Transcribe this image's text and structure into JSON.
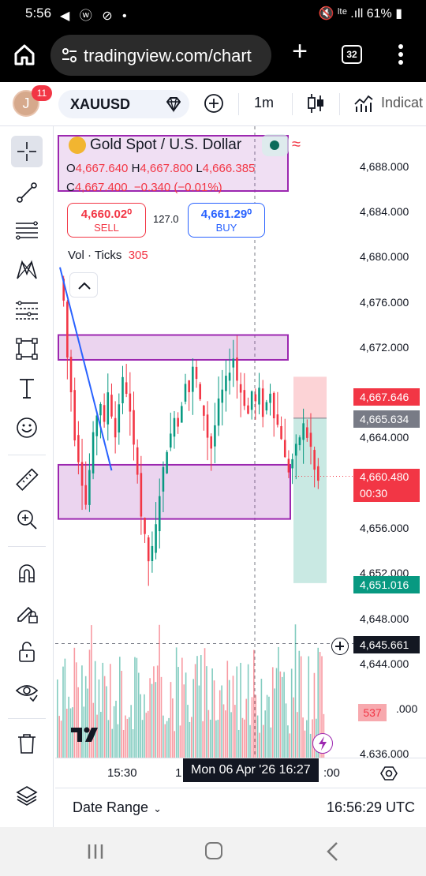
{
  "status_bar": {
    "time": "5:56",
    "icons": "◀ ⓦ ⊘ •",
    "right": "🔇 ˡᵗᵉ .ıll 61% ▮",
    "battery": "61%"
  },
  "browser": {
    "url": "tradingview.com/chart",
    "tab_count": "32"
  },
  "toolbar": {
    "avatar_letter": "J",
    "notification_count": "11",
    "symbol": "XAUUSD",
    "interval": "1m",
    "indicators_label": "Indicat"
  },
  "legend": {
    "title": "Gold Spot / U.S. Dollar",
    "wave_symbol": "≈",
    "open_key": "O",
    "open": "4,667.640",
    "high_key": "H",
    "high": "4,667.800",
    "low_key": "L",
    "low": "4,666.385",
    "close_key": "C",
    "close": "4,667.400",
    "change": "−0.340 (−0.01%)"
  },
  "trade": {
    "sell_price": "4,660.02⁰",
    "sell_label": "SELL",
    "spread": "127.0",
    "buy_price": "4,661.29⁰",
    "buy_label": "BUY"
  },
  "volume_indicator": {
    "label": "Vol · Ticks",
    "value": "305",
    "badge": "537"
  },
  "price_axis": {
    "ticks": [
      "4,688.000",
      "4,684.000",
      "4,680.000",
      "4,676.000",
      "4,672.000",
      "4,664.000",
      "4,656.000",
      "4,652.000",
      "4,648.000",
      "4,644.000",
      ".000",
      "4.636.000"
    ],
    "tick_values": [
      4688,
      4684,
      4680,
      4676,
      4672,
      4664,
      4656,
      4652,
      4648,
      4644,
      4640,
      4636
    ],
    "labels": {
      "take_profit": "4,667.646",
      "entry": "4,665.634",
      "last_price": "4,660.480",
      "countdown": "00:30",
      "stop": "4,651.016",
      "crosshair": "4,645.661"
    }
  },
  "time_axis": {
    "left_label": "15:30",
    "partial_label": "1",
    "right_partial": ":00",
    "crosshair_label": "Mon 06 Apr '26   16:27"
  },
  "bottom_bar": {
    "date_range": "Date Range",
    "clock": "16:56:29 UTC"
  },
  "colors": {
    "up": "#089981",
    "down": "#f23645",
    "zone": "#9c27b0",
    "zone_fill": "rgba(156,39,176,0.2)",
    "trend": "#2962ff",
    "accent": "#2962ff"
  },
  "chart_data": {
    "type": "candlestick",
    "symbol": "XAUUSD",
    "interval": "1m",
    "y_range": [
      4634,
      4691
    ],
    "zones": [
      {
        "top": 4673.0,
        "bottom": 4670.8
      },
      {
        "top": 4661.5,
        "bottom": 4656.7
      }
    ],
    "position": {
      "entry": 4665.634,
      "target": 4667.646,
      "stop": 4651.016
    },
    "last_price": 4660.48,
    "crosshair_price": 4645.661,
    "trendline": {
      "from": [
        0,
        4679
      ],
      "to": [
        14,
        4661
      ]
    },
    "ohlc_path": [
      4678,
      4676,
      4671,
      4668,
      4664,
      4662,
      4660,
      4658,
      4661,
      4664,
      4666,
      4667,
      4665,
      4668,
      4666,
      4664,
      4667,
      4669,
      4668,
      4666,
      4663,
      4661,
      4657,
      4655,
      4653,
      4654,
      4656,
      4659,
      4661,
      4663,
      4664,
      4666,
      4665,
      4667,
      4669,
      4668,
      4670,
      4669,
      4667,
      4666,
      4664,
      4663,
      4665,
      4667,
      4668,
      4669,
      4670,
      4671,
      4669,
      4668,
      4667,
      4666,
      4668,
      4667,
      4668,
      4666,
      4667,
      4668,
      4666,
      4665,
      4664,
      4662,
      4661,
      4662,
      4663,
      4664,
      4665,
      4664,
      4663,
      4661,
      4660
    ]
  }
}
